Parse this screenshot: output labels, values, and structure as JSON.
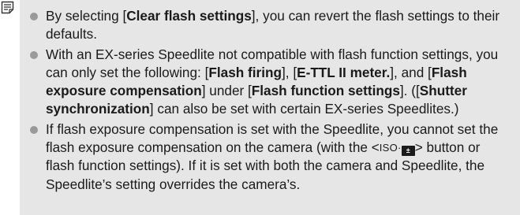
{
  "notes": [
    {
      "parts": [
        {
          "t": "By selecting ["
        },
        {
          "t": "Clear flash settings",
          "b": true
        },
        {
          "t": "], you can revert the flash settings to their defaults."
        }
      ]
    },
    {
      "parts": [
        {
          "t": "With an EX-series Speedlite not compatible with flash function settings, you can only set the following: ["
        },
        {
          "t": "Flash firing",
          "b": true
        },
        {
          "t": "], ["
        },
        {
          "t": "E-TTL II meter.",
          "b": true
        },
        {
          "t": "], and ["
        },
        {
          "t": "Flash exposure compensation",
          "b": true
        },
        {
          "t": "] under ["
        },
        {
          "t": "Flash function settings",
          "b": true
        },
        {
          "t": "]. (["
        },
        {
          "t": "Shutter synchronization",
          "b": true
        },
        {
          "t": "] can also be set with certain EX-series Speedlites.)"
        }
      ]
    },
    {
      "parts": [
        {
          "t": "If flash exposure compensation is set with the Speedlite, you cannot set the flash exposure compensation on the camera (with the <"
        },
        {
          "t": "ISO·",
          "glyph": "btn"
        },
        {
          "t": "±",
          "glyph": "flash-comp"
        },
        {
          "t": "> button or flash function settings). If it is set with both the camera and Speedlite, the Speedlite’s setting overrides the camera’s."
        }
      ]
    }
  ],
  "icons": {
    "note": "note-page-icon",
    "bullet": "gray-circle-bullet",
    "flash_comp": "flash-exposure-compensation-icon"
  },
  "colors": {
    "panel_bg": "#e6e6e6",
    "bullet": "#9a9a9a",
    "text": "#1a1a1a"
  }
}
